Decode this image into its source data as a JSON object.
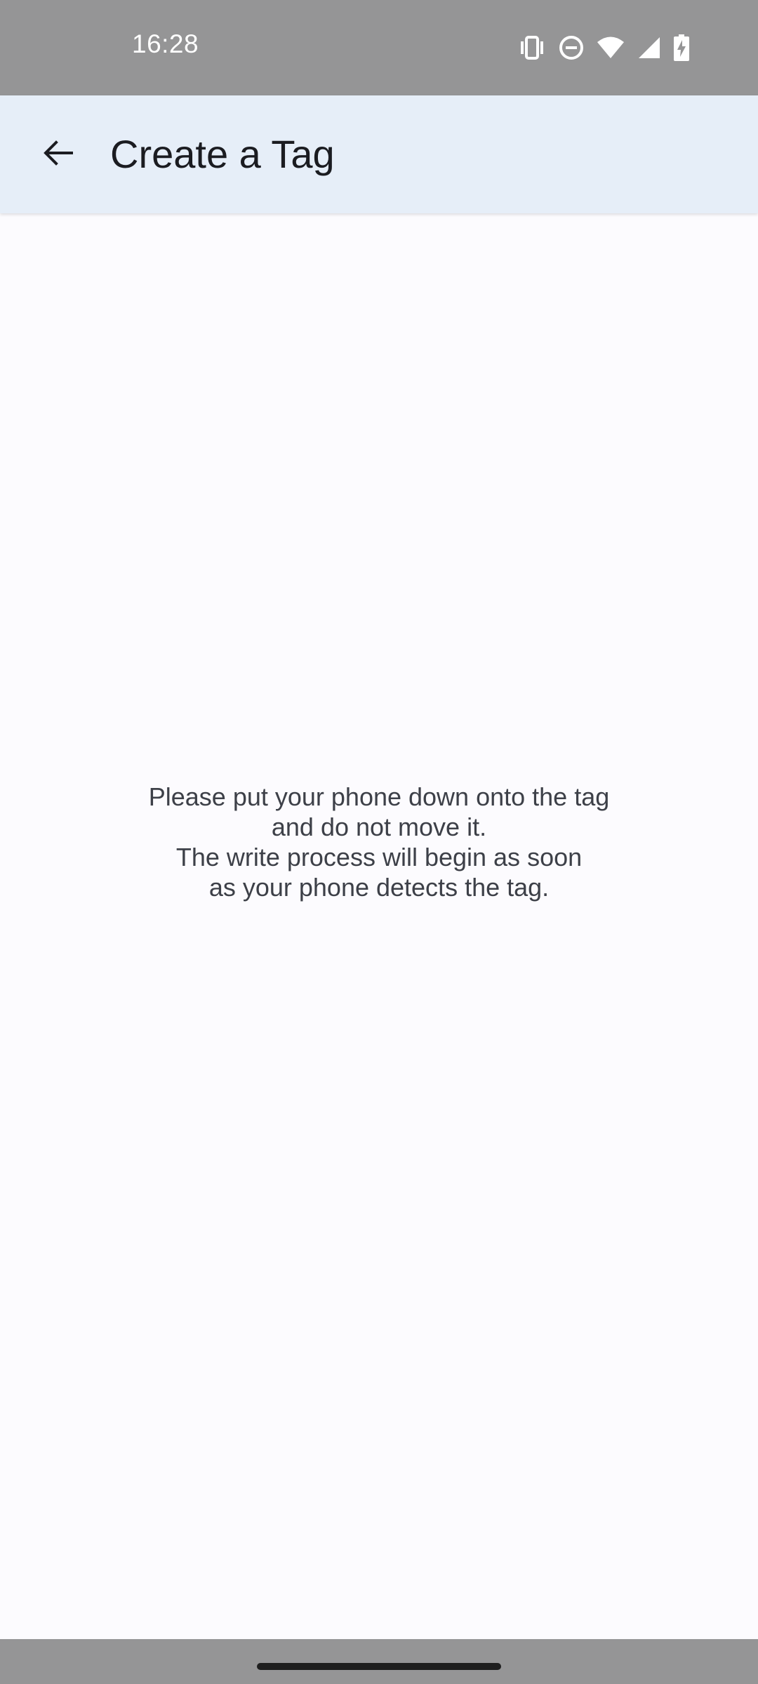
{
  "status_bar": {
    "time": "16:28",
    "icons": [
      "vibrate-icon",
      "do-not-disturb-icon",
      "wifi-icon",
      "cell-signal-icon",
      "battery-charging-icon"
    ]
  },
  "app_bar": {
    "back_icon": "arrow-back-icon",
    "title": "Create a Tag",
    "background": "#e6eef8"
  },
  "main": {
    "instruction": "Please put your phone down onto the tag\nand do not move it.\nThe write process will begin as soon\nas your phone detects the tag."
  },
  "colors": {
    "status_bar_bg": "#959596",
    "page_bg": "#fcfbfe",
    "text": "#3d4048",
    "title": "#1b1c21"
  }
}
